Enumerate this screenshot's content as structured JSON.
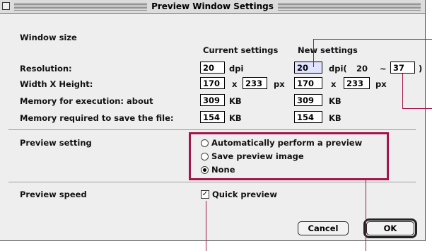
{
  "window": {
    "title": "Preview Window Settings"
  },
  "window_size": {
    "heading": "Window size",
    "current_header": "Current settings",
    "new_header": "New settings",
    "resolution": {
      "label": "Resolution:",
      "current": "20",
      "current_unit": "dpi",
      "new": "20",
      "new_unit": "dpi(",
      "range_min": "20",
      "range_sep": "~",
      "range_max": "37",
      "range_close": ")"
    },
    "width_height": {
      "label": "Width X Height:",
      "current_w": "170",
      "x": "x",
      "current_h": "233",
      "unit": "px",
      "new_w": "170",
      "new_h": "233"
    },
    "memory_exec": {
      "label": "Memory for execution: about",
      "current": "309",
      "new": "309",
      "unit": "KB"
    },
    "memory_save": {
      "label": "Memory required to save the file:",
      "current": "154",
      "new": "154",
      "unit": "KB"
    }
  },
  "preview_setting": {
    "label": "Preview setting",
    "options": [
      {
        "label": "Automatically perform a preview",
        "selected": false
      },
      {
        "label": "Save preview image",
        "selected": false
      },
      {
        "label": "None",
        "selected": true
      }
    ]
  },
  "preview_speed": {
    "label": "Preview speed",
    "quick_preview": "Quick preview",
    "checked": true,
    "check_glyph": "✓"
  },
  "buttons": {
    "cancel": "Cancel",
    "ok": "OK"
  },
  "colors": {
    "callout": "#a3154c",
    "highlight": "#dfe3ff",
    "window_bg": "#eeeeee"
  }
}
